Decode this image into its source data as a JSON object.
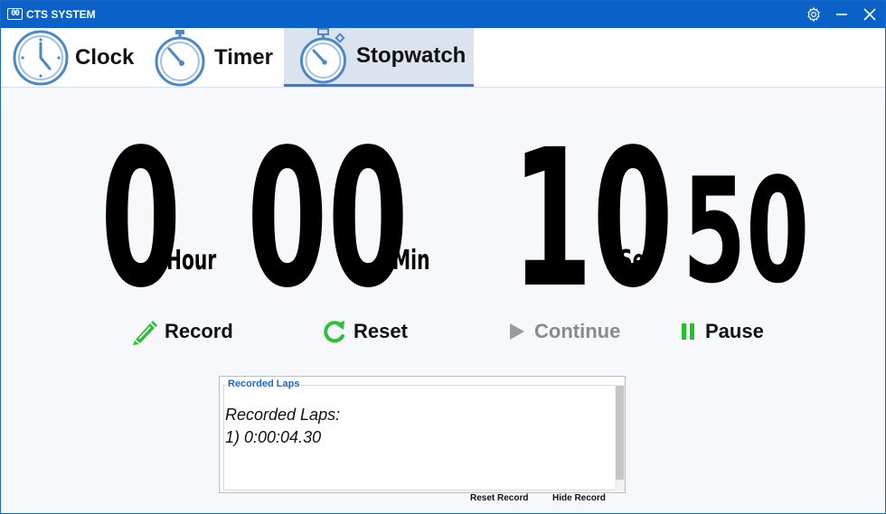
{
  "window": {
    "app_icon_text": "00",
    "title": "CTS SYSTEM",
    "buttons": {
      "settings": "gear-icon",
      "minimize": "minimize-icon",
      "close": "close-icon"
    }
  },
  "tabs": [
    {
      "label": "Clock",
      "icon": "clock-icon",
      "active": false
    },
    {
      "label": "Timer",
      "icon": "timer-icon",
      "active": false
    },
    {
      "label": "Stopwatch",
      "icon": "stopwatch-icon",
      "active": true
    }
  ],
  "display": {
    "hours": "0",
    "hour_unit": "Hour",
    "minutes": "00",
    "minute_unit": "Min",
    "seconds": "10",
    "second_unit": "Sec",
    "centiseconds": "50"
  },
  "actions": {
    "record": "Record",
    "reset": "Reset",
    "continue": "Continue",
    "pause": "Pause"
  },
  "laps": {
    "legend": "Recorded Laps",
    "heading": "Recorded Laps:",
    "entries": [
      "1) 0:00:04.30"
    ]
  },
  "footer": {
    "reset_record": "Reset Record",
    "hide_record": "Hide Record"
  },
  "colors": {
    "titlebar": "#0a62c9",
    "accent": "#3a7bd5",
    "record_icon": "#2fbf3a",
    "reset_icon": "#2fbf3a",
    "pause_icon": "#22c22a",
    "continue_disabled": "#9a9a9a"
  }
}
